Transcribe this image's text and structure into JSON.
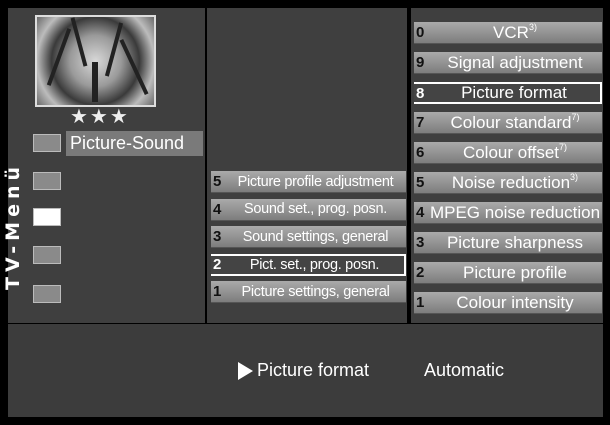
{
  "menu": {
    "vertical_title": "TV-Menü",
    "stars": "★★★",
    "active_section": "Picture-Sound",
    "mid_items": [
      {
        "num": "5",
        "label": "Picture profile adjustment",
        "sup": ""
      },
      {
        "num": "4",
        "label": "Sound set., prog. posn.",
        "sup": ""
      },
      {
        "num": "3",
        "label": "Sound settings, general",
        "sup": ""
      },
      {
        "num": "2",
        "label": "Pict. set., prog. posn.",
        "sup": ""
      },
      {
        "num": "1",
        "label": "Picture settings, general",
        "sup": ""
      }
    ],
    "right_items": [
      {
        "num": "0",
        "label": "VCR",
        "sup": "3)"
      },
      {
        "num": "9",
        "label": "Signal adjustment",
        "sup": ""
      },
      {
        "num": "8",
        "label": "Picture format",
        "sup": ""
      },
      {
        "num": "7",
        "label": "Colour standard",
        "sup": "7)"
      },
      {
        "num": "6",
        "label": "Colour offset",
        "sup": "7)"
      },
      {
        "num": "5",
        "label": "Noise reduction",
        "sup": "3)"
      },
      {
        "num": "4",
        "label": "MPEG noise reduction",
        "sup": ""
      },
      {
        "num": "3",
        "label": "Picture sharpness",
        "sup": ""
      },
      {
        "num": "2",
        "label": "Picture profile",
        "sup": ""
      },
      {
        "num": "1",
        "label": "Colour intensity",
        "sup": ""
      }
    ]
  },
  "status": {
    "setting_label": "Picture format",
    "setting_value": "Automatic"
  }
}
